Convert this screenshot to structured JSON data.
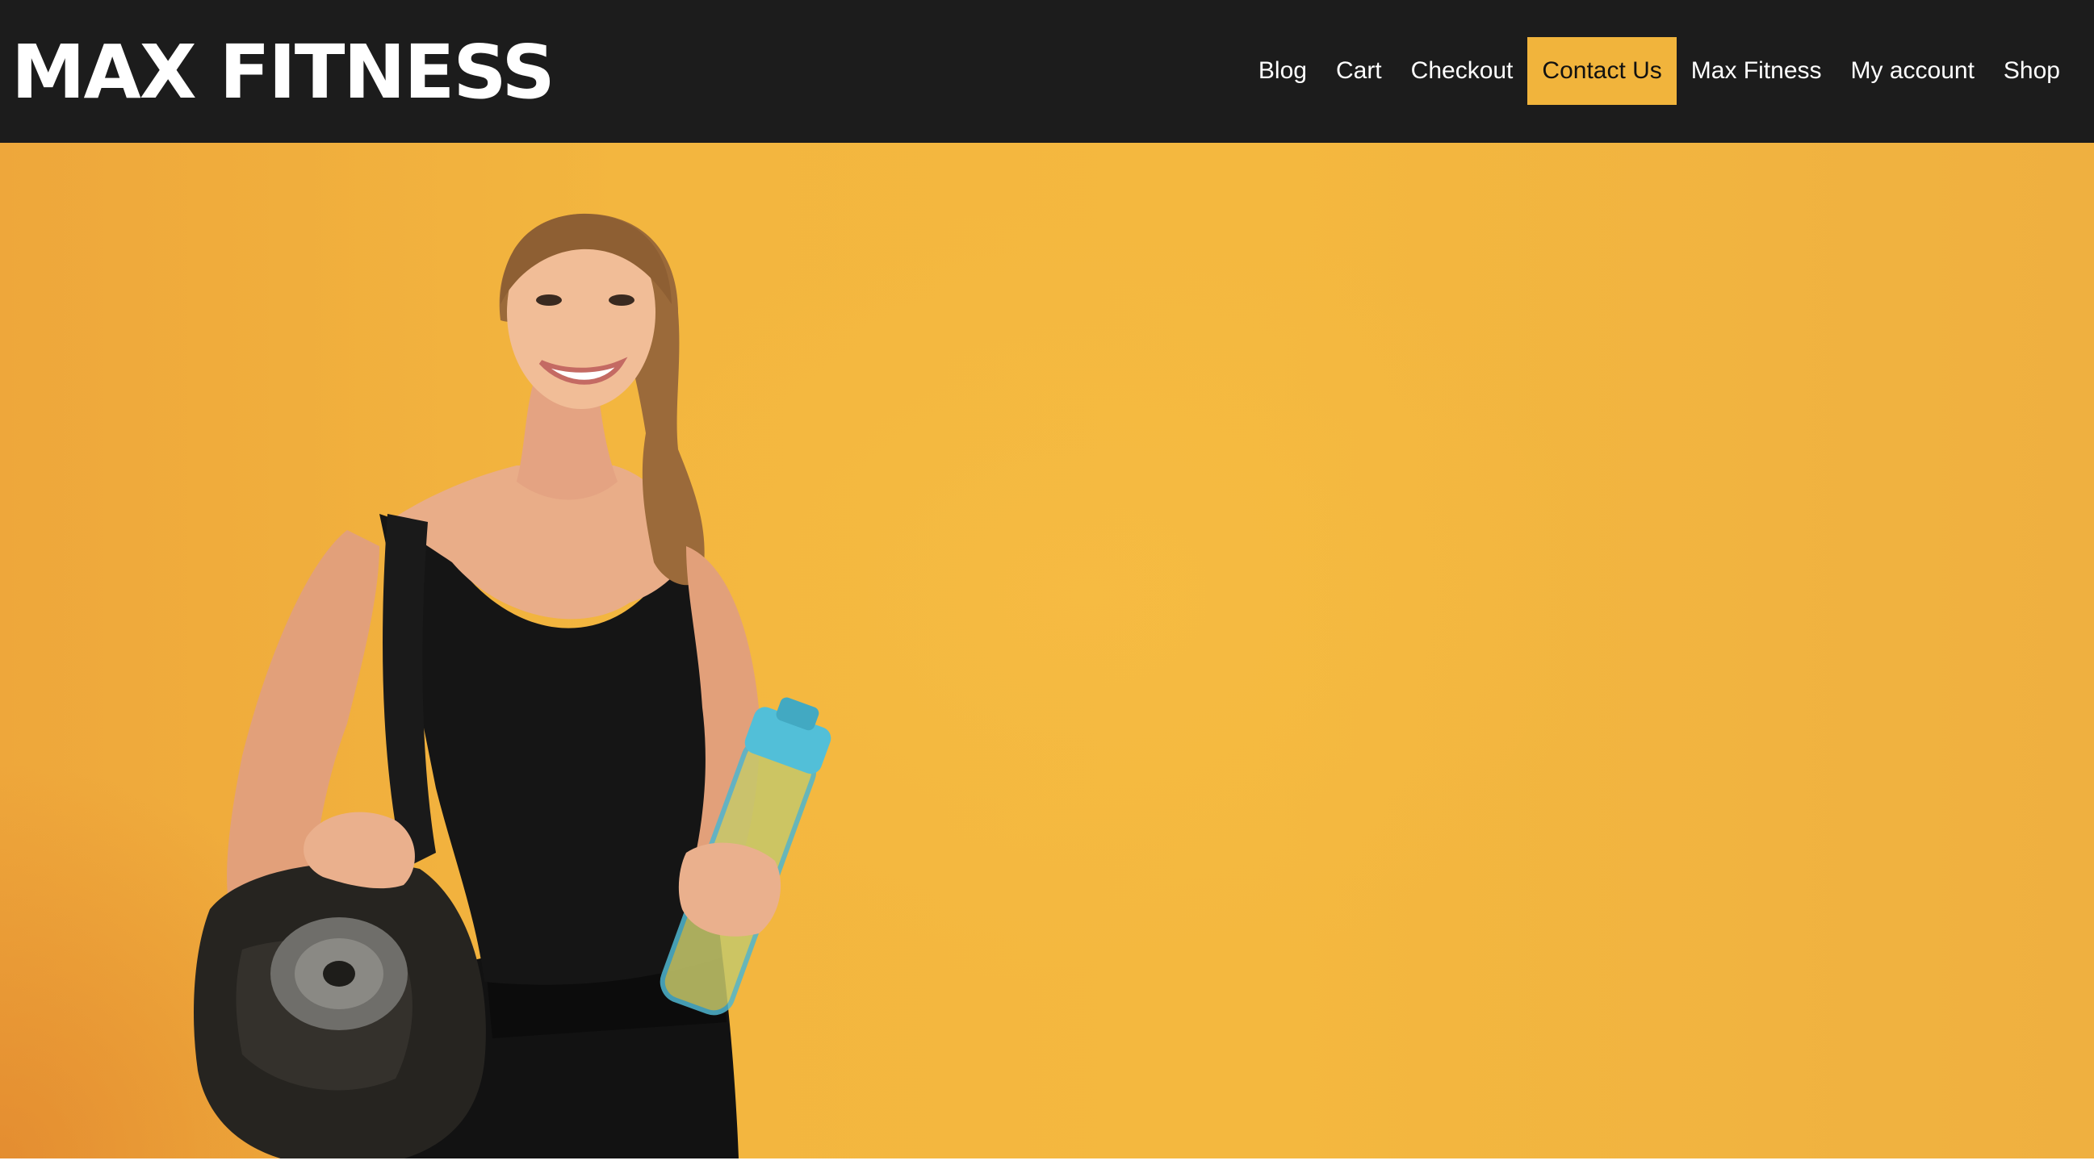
{
  "site": {
    "title": "MAX FITNESS"
  },
  "nav": {
    "items": [
      {
        "label": "Blog"
      },
      {
        "label": "Cart"
      },
      {
        "label": "Checkout"
      },
      {
        "label": "Contact Us",
        "active": true
      },
      {
        "label": "Max Fitness"
      },
      {
        "label": "My account"
      },
      {
        "label": "Shop"
      }
    ]
  },
  "colors": {
    "header_bg": "#1c1c1c",
    "accent": "#f1b43c",
    "hero_bg": "#f3b63f"
  },
  "hero": {
    "image_subject": "woman-with-gym-bag-yoga-mat-and-water-bottle"
  }
}
